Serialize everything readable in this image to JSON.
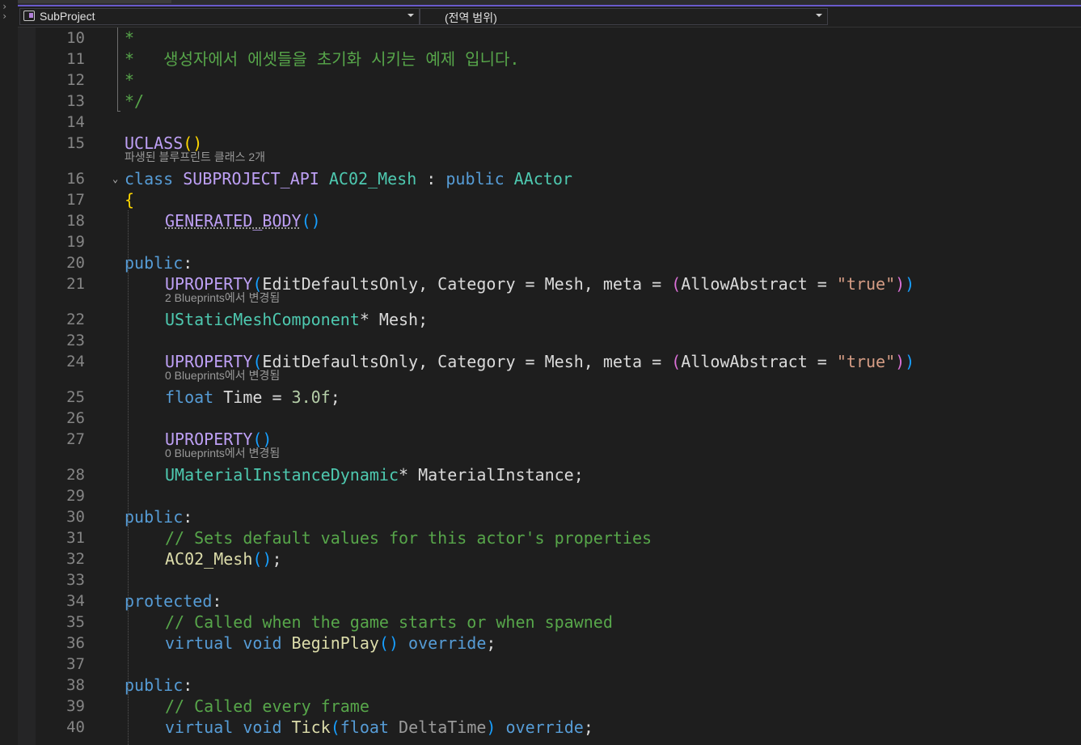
{
  "navigation": {
    "project": "SubProject",
    "scope": "(전역 범위)"
  },
  "lines": [
    {
      "n": "10",
      "segs": [
        {
          "c": "cmt",
          "t": "*"
        }
      ]
    },
    {
      "n": "11",
      "segs": [
        {
          "c": "cmt",
          "t": "*   생성자에서 에셋들을 초기화 시키는 예제 입니다."
        }
      ]
    },
    {
      "n": "12",
      "segs": [
        {
          "c": "cmt",
          "t": "*"
        }
      ]
    },
    {
      "n": "13",
      "segs": [
        {
          "c": "cmt",
          "t": "*/"
        }
      ]
    },
    {
      "n": "14",
      "segs": []
    },
    {
      "n": "15",
      "segs": [
        {
          "c": "macro",
          "t": "UCLASS"
        },
        {
          "c": "p1",
          "t": "()"
        }
      ]
    },
    {
      "n": "16",
      "segs": [
        {
          "c": "kw",
          "t": "class "
        },
        {
          "c": "macro",
          "t": "SUBPROJECT_API "
        },
        {
          "c": "cls",
          "t": "AC02_Mesh"
        },
        {
          "c": "txt",
          "t": " : "
        },
        {
          "c": "kw",
          "t": "public "
        },
        {
          "c": "cls",
          "t": "AActor"
        }
      ]
    },
    {
      "n": "17",
      "segs": [
        {
          "c": "p1",
          "t": "{"
        }
      ]
    },
    {
      "n": "18",
      "indent": true,
      "segs": [
        {
          "c": "macro squig",
          "t": "GENERATED_BODY"
        },
        {
          "c": "p3",
          "t": "()"
        }
      ]
    },
    {
      "n": "19",
      "segs": []
    },
    {
      "n": "20",
      "segs": [
        {
          "c": "kw",
          "t": "public"
        },
        {
          "c": "txt",
          "t": ":"
        }
      ]
    },
    {
      "n": "21",
      "indent": true,
      "segs": [
        {
          "c": "macro",
          "t": "UPROPERTY"
        },
        {
          "c": "p3",
          "t": "("
        },
        {
          "c": "txt",
          "t": "EditDefaultsOnly, Category = Mesh, meta = "
        },
        {
          "c": "p2",
          "t": "("
        },
        {
          "c": "txt",
          "t": "AllowAbstract = "
        },
        {
          "c": "str",
          "t": "\"true\""
        },
        {
          "c": "p2",
          "t": ")"
        },
        {
          "c": "p3",
          "t": ")"
        }
      ]
    },
    {
      "n": "22",
      "indent": true,
      "segs": [
        {
          "c": "cls",
          "t": "UStaticMeshComponent"
        },
        {
          "c": "txt",
          "t": "* Mesh;"
        }
      ]
    },
    {
      "n": "23",
      "segs": []
    },
    {
      "n": "24",
      "indent": true,
      "segs": [
        {
          "c": "macro",
          "t": "UPROPERTY"
        },
        {
          "c": "p3",
          "t": "("
        },
        {
          "c": "txt",
          "t": "EditDefaultsOnly, Category = Mesh, meta = "
        },
        {
          "c": "p2",
          "t": "("
        },
        {
          "c": "txt",
          "t": "AllowAbstract = "
        },
        {
          "c": "str",
          "t": "\"true\""
        },
        {
          "c": "p2",
          "t": ")"
        },
        {
          "c": "p3",
          "t": ")"
        }
      ]
    },
    {
      "n": "25",
      "indent": true,
      "segs": [
        {
          "c": "kw",
          "t": "float"
        },
        {
          "c": "txt",
          "t": " Time = "
        },
        {
          "c": "num",
          "t": "3.0f"
        },
        {
          "c": "txt",
          "t": ";"
        }
      ]
    },
    {
      "n": "26",
      "segs": []
    },
    {
      "n": "27",
      "indent": true,
      "segs": [
        {
          "c": "macro",
          "t": "UPROPERTY"
        },
        {
          "c": "p3",
          "t": "()"
        }
      ]
    },
    {
      "n": "28",
      "indent": true,
      "segs": [
        {
          "c": "cls",
          "t": "UMaterialInstanceDynamic"
        },
        {
          "c": "txt",
          "t": "* MaterialInstance;"
        }
      ]
    },
    {
      "n": "29",
      "segs": []
    },
    {
      "n": "30",
      "segs": [
        {
          "c": "kw",
          "t": "public"
        },
        {
          "c": "txt",
          "t": ":"
        }
      ]
    },
    {
      "n": "31",
      "indent": true,
      "segs": [
        {
          "c": "cmt",
          "t": "// Sets default values for this actor's properties"
        }
      ]
    },
    {
      "n": "32",
      "indent": true,
      "segs": [
        {
          "c": "fn",
          "t": "AC02_Mesh"
        },
        {
          "c": "p3",
          "t": "()"
        },
        {
          "c": "txt",
          "t": ";"
        }
      ]
    },
    {
      "n": "33",
      "segs": []
    },
    {
      "n": "34",
      "segs": [
        {
          "c": "kw",
          "t": "protected"
        },
        {
          "c": "txt",
          "t": ":"
        }
      ]
    },
    {
      "n": "35",
      "indent": true,
      "segs": [
        {
          "c": "cmt",
          "t": "// Called when the game starts or when spawned"
        }
      ]
    },
    {
      "n": "36",
      "indent": true,
      "segs": [
        {
          "c": "kw",
          "t": "virtual void "
        },
        {
          "c": "fn",
          "t": "BeginPlay"
        },
        {
          "c": "p3",
          "t": "()"
        },
        {
          "c": "kw",
          "t": " override"
        },
        {
          "c": "txt",
          "t": ";"
        }
      ]
    },
    {
      "n": "37",
      "segs": []
    },
    {
      "n": "38",
      "segs": [
        {
          "c": "kw",
          "t": "public"
        },
        {
          "c": "txt",
          "t": ":"
        }
      ]
    },
    {
      "n": "39",
      "indent": true,
      "segs": [
        {
          "c": "cmt",
          "t": "// Called every frame"
        }
      ]
    },
    {
      "n": "40",
      "indent": true,
      "segs": [
        {
          "c": "kw",
          "t": "virtual void "
        },
        {
          "c": "fn",
          "t": "Tick"
        },
        {
          "c": "p3",
          "t": "("
        },
        {
          "c": "kw",
          "t": "float"
        },
        {
          "c": "param",
          "t": " DeltaTime"
        },
        {
          "c": "p3",
          "t": ")"
        },
        {
          "c": "kw",
          "t": " override"
        },
        {
          "c": "txt",
          "t": ";"
        }
      ]
    }
  ],
  "codelens": [
    {
      "after": "15",
      "indent": 0,
      "text": "파생된 블루프린트 클래스 2개"
    },
    {
      "after": "21",
      "indent": 1,
      "text": "2 Blueprints에서 변경됨"
    },
    {
      "after": "24",
      "indent": 1,
      "text": "0 Blueprints에서 변경됨"
    },
    {
      "after": "27",
      "indent": 1,
      "text": "0 Blueprints에서 변경됨"
    }
  ]
}
